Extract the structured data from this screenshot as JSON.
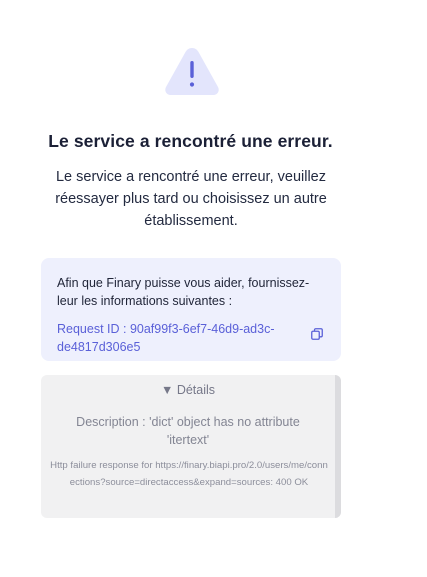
{
  "icons": {
    "warning": "warning-triangle-icon",
    "copy": "copy-icon",
    "toggle": "triangle-down-icon"
  },
  "colors": {
    "warning_fill": "#e3e5fc",
    "warning_mark": "#5a60d8",
    "accent": "#5a60d8",
    "title": "#1b2036",
    "info_bg": "#eef0fd",
    "details_bg": "#f1f1f2"
  },
  "error": {
    "title": "Le service a rencontré une erreur.",
    "message": "Le service a rencontré une erreur, veuillez réessayer plus tard ou choisissez un autre établissement."
  },
  "info": {
    "text": "Afin que Finary puisse vous aider, fournissez-leur les informations suivantes :",
    "request_id": "Request ID : 90af99f3-6ef7-46d9-ad3c-de4817d306e5"
  },
  "details": {
    "toggle_label": "▼ Détails",
    "description": "Description : 'dict' object has no attribute 'itertext'",
    "http": "Http failure response for https://finary.biapi.pro/2.0/users/me/connections?source=directaccess&expand=sources: 400 OK"
  }
}
